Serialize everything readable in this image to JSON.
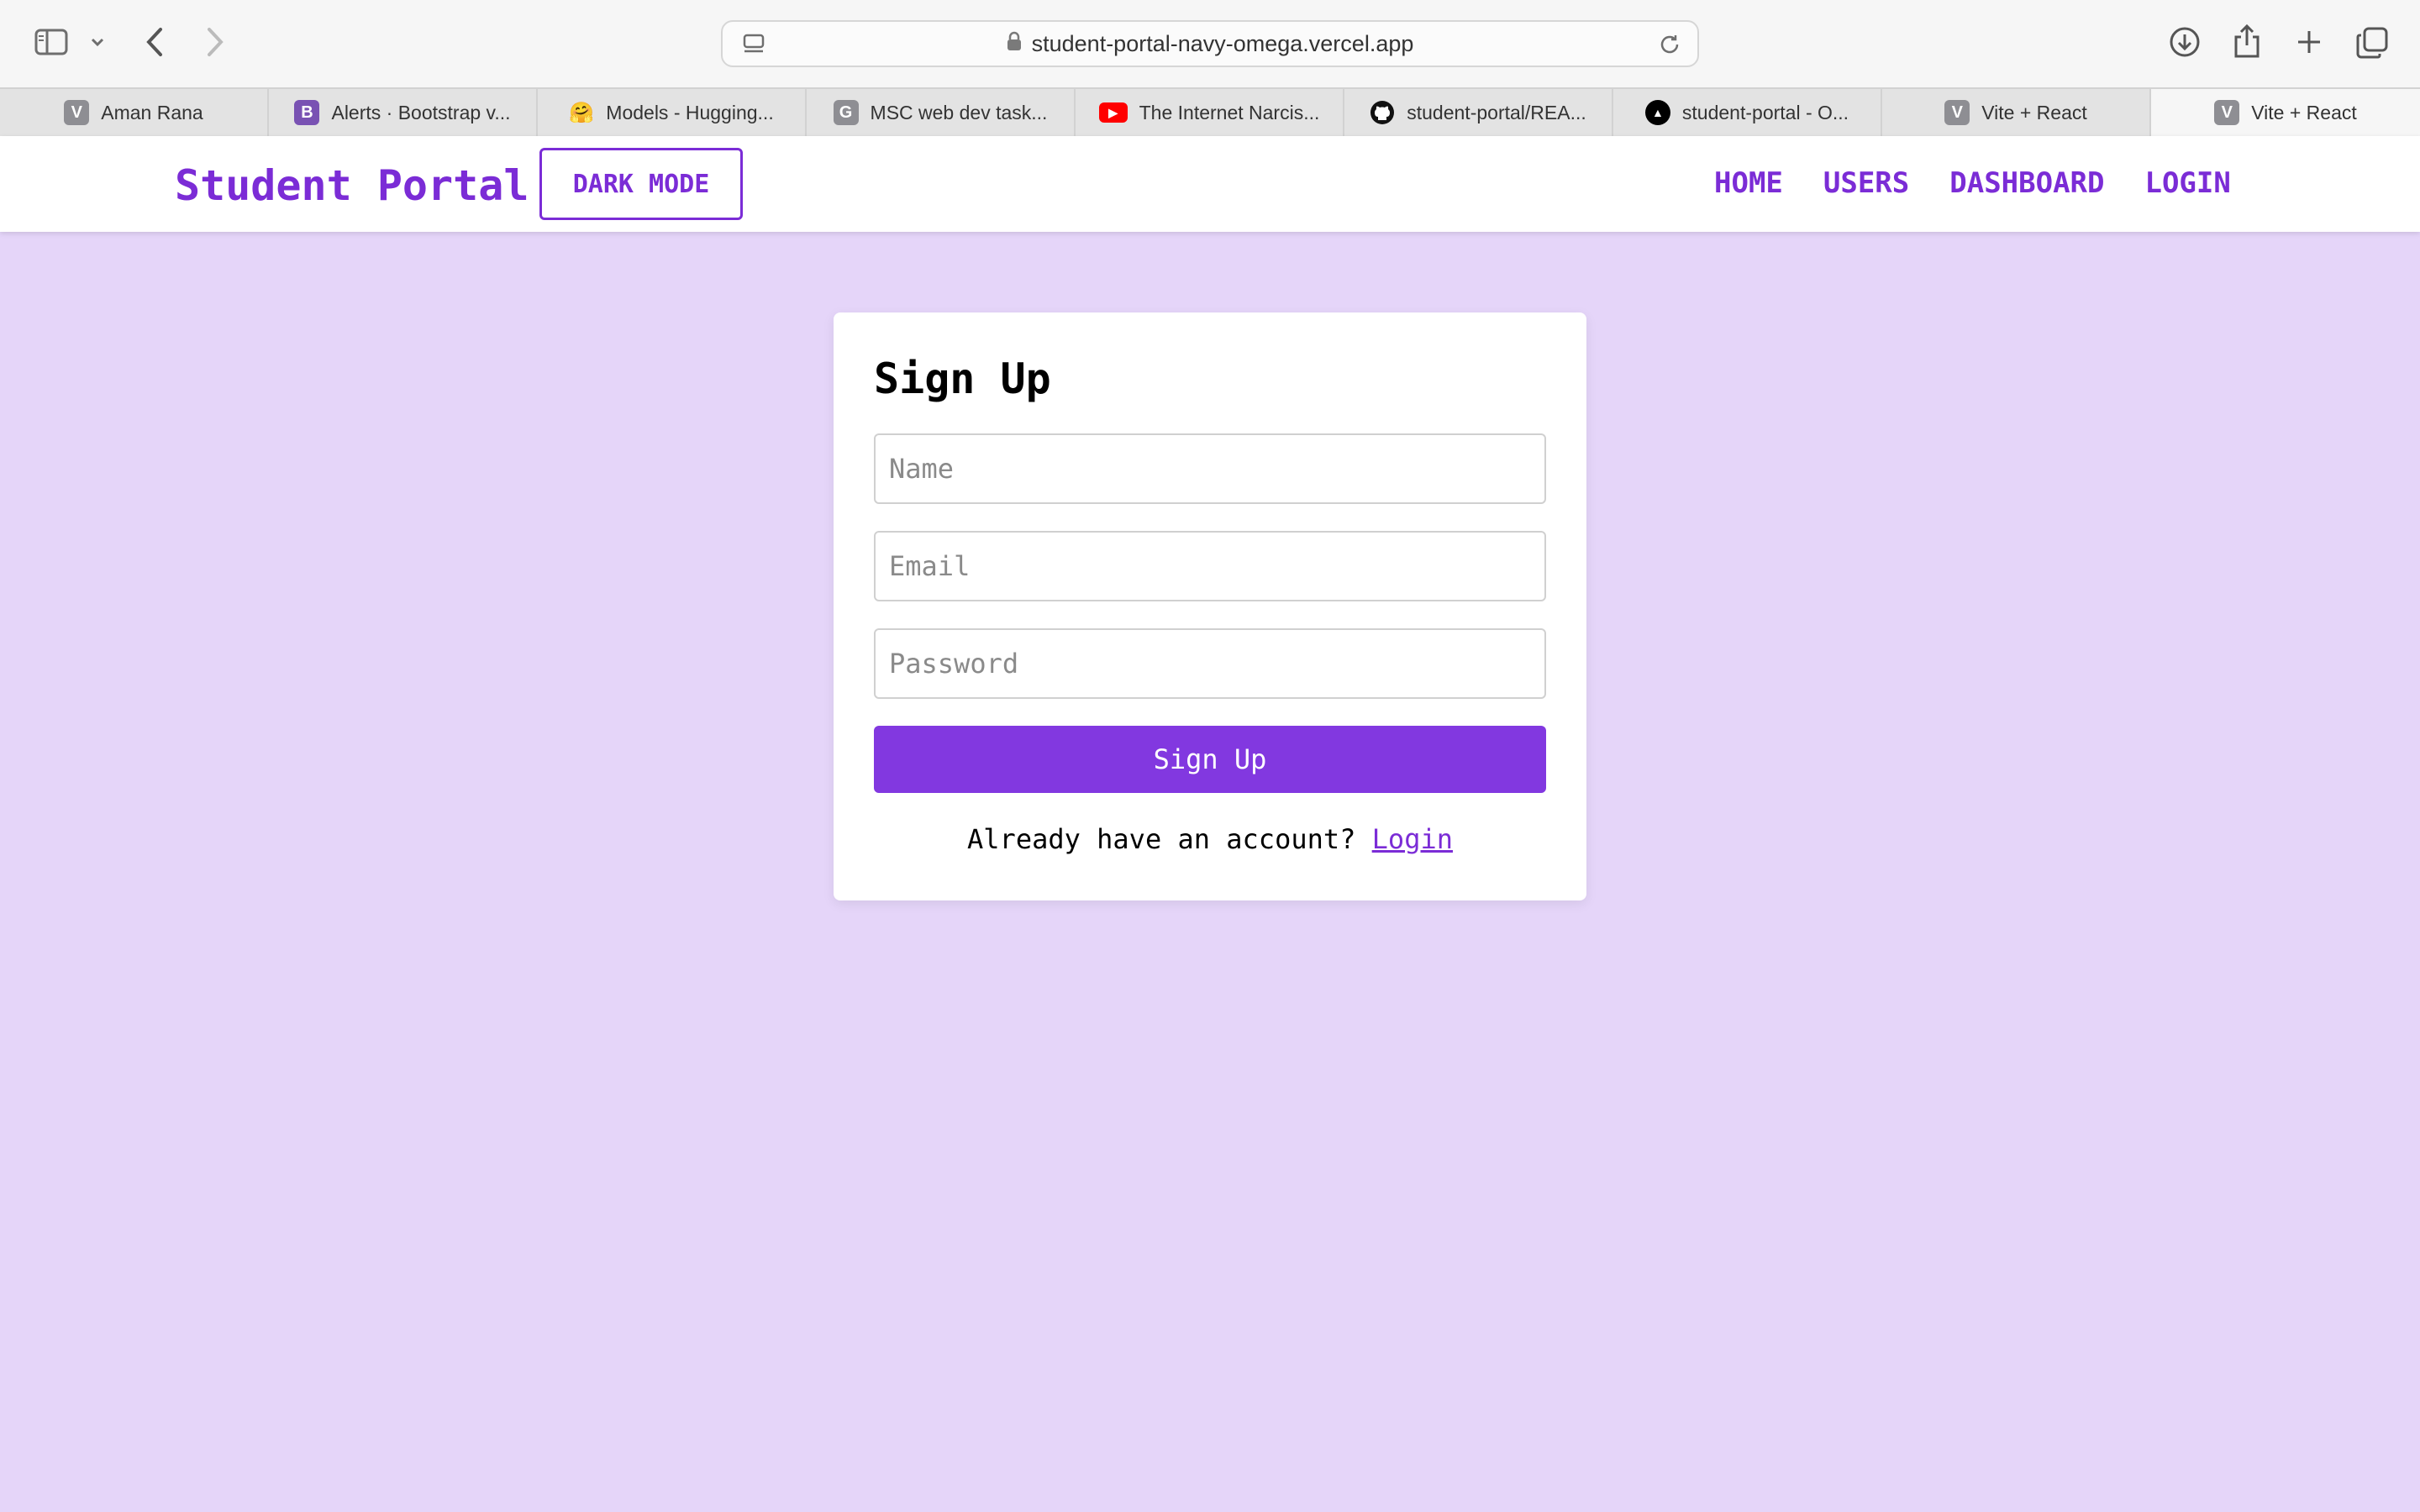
{
  "browser": {
    "url": "student-portal-navy-omega.vercel.app",
    "tabs": [
      {
        "favicon": "V",
        "favicon_color": "#8e8e93",
        "title": "Aman Rana"
      },
      {
        "favicon": "B",
        "favicon_color": "#7952b3",
        "title": "Alerts · Bootstrap v..."
      },
      {
        "favicon": "🤗",
        "favicon_color": "transparent",
        "title": "Models - Hugging..."
      },
      {
        "favicon": "G",
        "favicon_color": "#8e8e93",
        "title": "MSC web dev task..."
      },
      {
        "favicon": "▶",
        "favicon_color": "#ff0000",
        "title": "The Internet Narcis..."
      },
      {
        "favicon": "github-icon",
        "favicon_color": "#000000",
        "title": "student-portal/REA..."
      },
      {
        "favicon": "▲",
        "favicon_color": "#000000",
        "title": "student-portal - O..."
      },
      {
        "favicon": "V",
        "favicon_color": "#8e8e93",
        "title": "Vite + React"
      },
      {
        "favicon": "V",
        "favicon_color": "#8e8e93",
        "title": "Vite + React"
      }
    ]
  },
  "navbar": {
    "brand": "Student Portal",
    "dark_mode_label": "DARK MODE",
    "links": [
      "HOME",
      "USERS",
      "DASHBOARD",
      "LOGIN"
    ]
  },
  "signup": {
    "title": "Sign Up",
    "name_placeholder": "Name",
    "email_placeholder": "Email",
    "password_placeholder": "Password",
    "submit_label": "Sign Up",
    "footer_text": "Already have an account?",
    "login_link": "Login"
  },
  "colors": {
    "accent": "#7b2cd6",
    "button": "#8238e0",
    "page_background": "#e5d5f9"
  }
}
